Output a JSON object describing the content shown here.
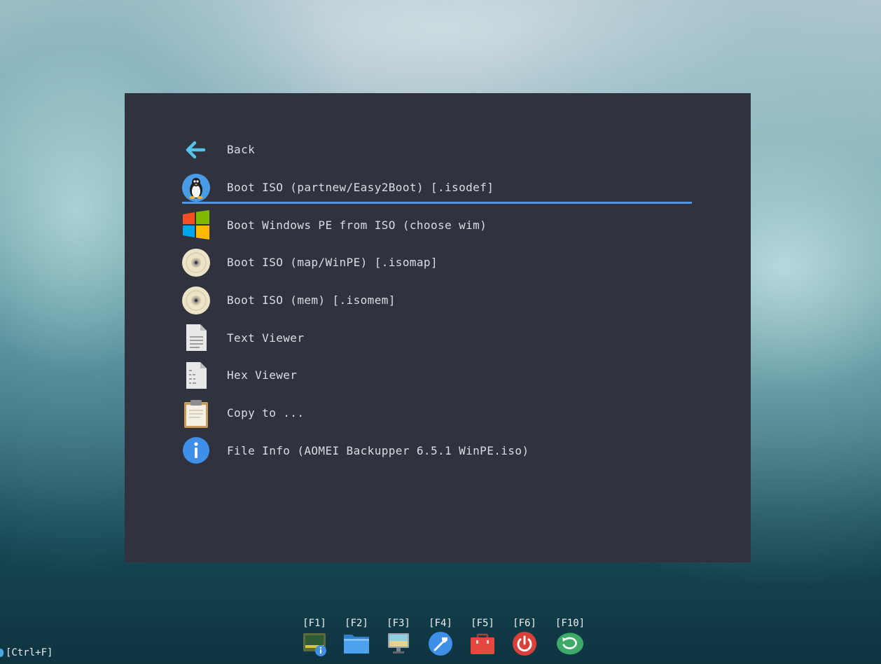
{
  "menu": {
    "items": [
      {
        "label": "Back",
        "icon": "back-arrow-icon"
      },
      {
        "label": "Boot ISO (partnew/Easy2Boot) [.isodef]",
        "icon": "linux-tux-icon",
        "selected": true
      },
      {
        "label": "Boot Windows PE from ISO (choose wim)",
        "icon": "windows-logo-icon"
      },
      {
        "label": "Boot ISO (map/WinPE) [.isomap]",
        "icon": "disc-icon"
      },
      {
        "label": "Boot ISO (mem) [.isomem]",
        "icon": "disc-icon"
      },
      {
        "label": "Text Viewer",
        "icon": "text-file-icon"
      },
      {
        "label": "Hex Viewer",
        "icon": "hex-file-icon"
      },
      {
        "label": "Copy to ...",
        "icon": "clipboard-icon"
      },
      {
        "label": "File Info (AOMEI Backupper 6.5.1 WinPE.iso)",
        "icon": "info-icon"
      }
    ]
  },
  "hotkeys": [
    {
      "label": "[F1]",
      "icon": "system-info-icon"
    },
    {
      "label": "[F2]",
      "icon": "folder-icon"
    },
    {
      "label": "[F3]",
      "icon": "monitor-icon"
    },
    {
      "label": "[F4]",
      "icon": "tools-icon"
    },
    {
      "label": "[F5]",
      "icon": "toolbox-icon"
    },
    {
      "label": "[F6]",
      "icon": "power-icon"
    },
    {
      "label": "[F10]",
      "icon": "reboot-icon"
    }
  ],
  "search_hint": "[Ctrl+F]",
  "colors": {
    "panel_bg": "#30333d",
    "selection_bar": "#5294e2",
    "text": "#d9dde3"
  }
}
